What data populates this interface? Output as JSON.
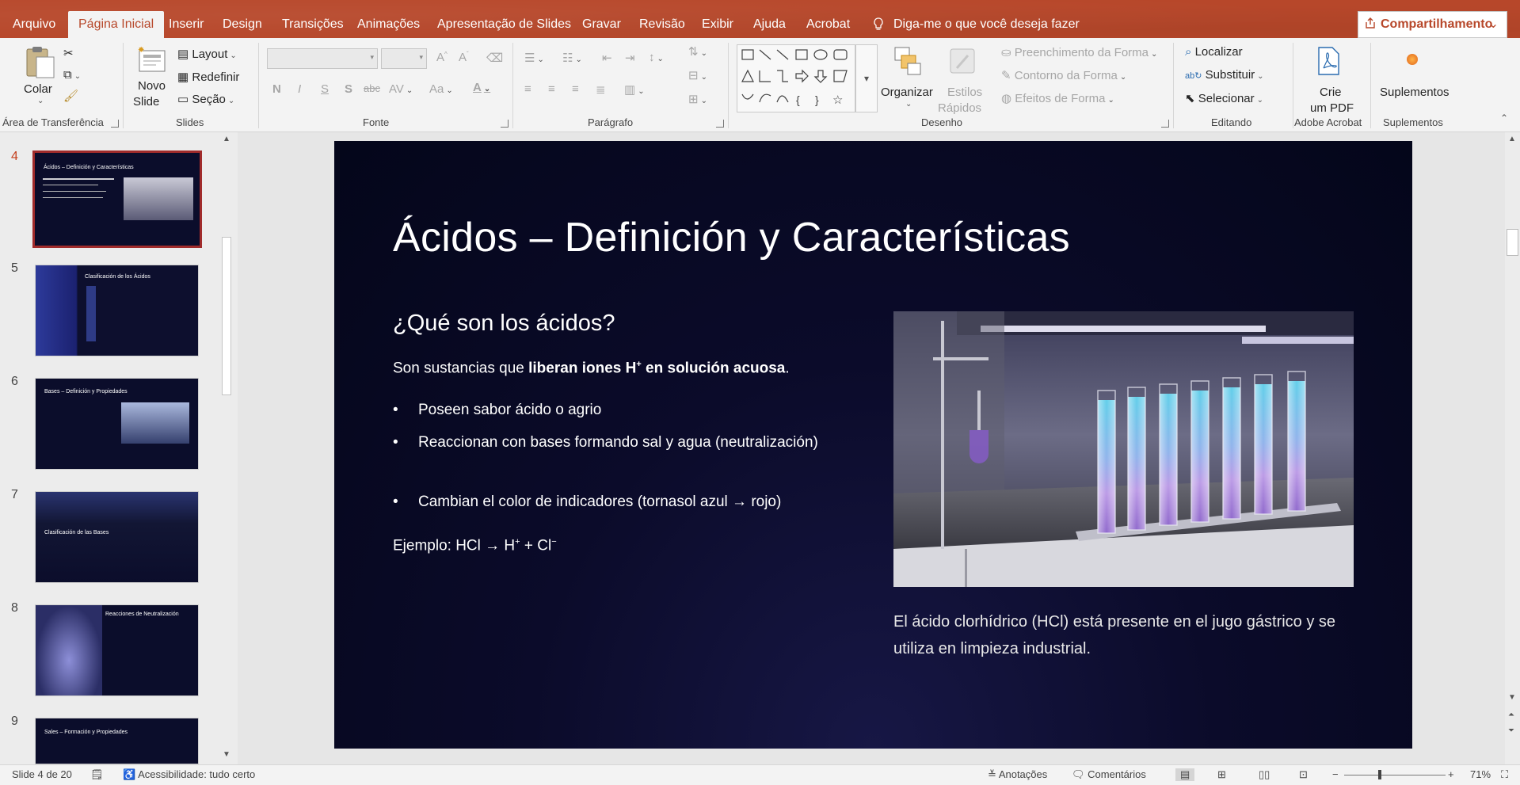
{
  "ribbon_tabs": {
    "file": "Arquivo",
    "home": "Página Inicial",
    "insert": "Inserir",
    "design": "Design",
    "transitions": "Transições",
    "animations": "Animações",
    "slideshow": "Apresentação de Slides",
    "record": "Gravar",
    "review": "Revisão",
    "view": "Exibir",
    "help": "Ajuda",
    "acrobat": "Acrobat"
  },
  "tell_me": "Diga-me o que você deseja fazer",
  "share_label": "Compartilhamento",
  "clipboard": {
    "paste": "Colar",
    "label": "Área de Transferência"
  },
  "slides_group": {
    "new_slide_line1": "Novo",
    "new_slide_line2": "Slide",
    "layout": "Layout",
    "reset": "Redefinir",
    "section": "Seção",
    "label": "Slides"
  },
  "font_group": {
    "label": "Fonte"
  },
  "paragraph_group": {
    "label": "Parágrafo"
  },
  "drawing_group": {
    "arrange": "Organizar",
    "quick_styles_line1": "Estilos",
    "quick_styles_line2": "Rápidos",
    "shape_fill": "Preenchimento da Forma",
    "shape_outline": "Contorno da Forma",
    "shape_effects": "Efeitos de Forma",
    "label": "Desenho"
  },
  "editing_group": {
    "find": "Localizar",
    "replace": "Substituir",
    "select": "Selecionar",
    "label": "Editando"
  },
  "acrobat_group": {
    "create_pdf_line1": "Crie",
    "create_pdf_line2": "um PDF",
    "label": "Adobe Acrobat"
  },
  "addins_group": {
    "addins": "Suplementos",
    "label": "Suplementos"
  },
  "thumbnails": [
    {
      "num": "4",
      "title": "Ácidos – Definición y Características",
      "active": true
    },
    {
      "num": "5",
      "title": "Clasificación de los Ácidos",
      "active": false
    },
    {
      "num": "6",
      "title": "Bases – Definición y Propiedades",
      "active": false
    },
    {
      "num": "7",
      "title": "Clasificación de las Bases",
      "active": false
    },
    {
      "num": "8",
      "title": "Reacciones de Neutralización",
      "active": false
    },
    {
      "num": "9",
      "title": "Sales – Formación y Propiedades",
      "active": false
    }
  ],
  "slide": {
    "title": "Ácidos – Definición y Características",
    "subtitle": "¿Qué son los ácidos?",
    "lead_prefix": "Son sustancias que ",
    "lead_bold": "liberan iones H",
    "lead_bold_sup": "+",
    "lead_bold_suffix": " en solución acuosa",
    "lead_end": ".",
    "bullets": [
      "Poseen sabor ácido o agrio",
      "Reaccionan con bases formando sal y agua (neutralización)",
      "Cambian el color de indicadores (tornasol azul → rojo)"
    ],
    "bullet_char": "•",
    "example_prefix": "Ejemplo: HCl → H",
    "example_sup1": "+",
    "example_mid": " + Cl",
    "example_sup2": "−",
    "caption": "El ácido clorhídrico (HCl) está presente en el jugo gástrico y se utiliza en limpieza industrial."
  },
  "status": {
    "slide_count": "Slide 4 de 20",
    "accessibility": "Acessibilidade: tudo certo",
    "notes": "Anotações",
    "comments": "Comentários",
    "zoom": "71%"
  }
}
